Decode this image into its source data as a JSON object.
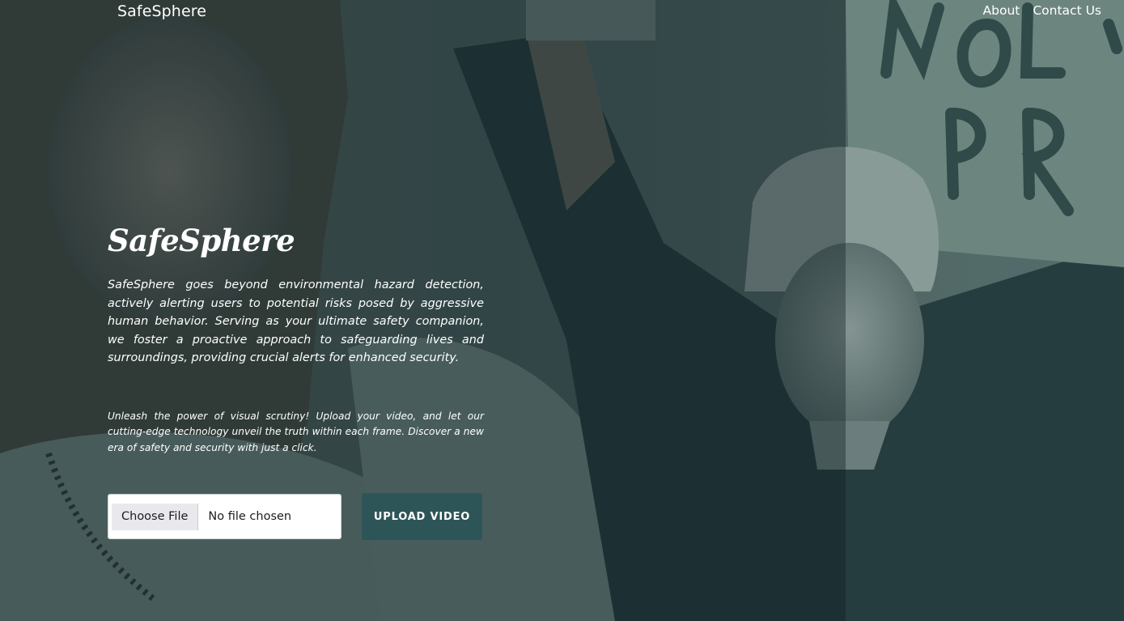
{
  "navbar": {
    "brand": "SafeSphere",
    "links": [
      {
        "label": "About"
      },
      {
        "label": "Contact Us"
      }
    ]
  },
  "hero": {
    "title": "SafeSphere",
    "description": "SafeSphere goes beyond environmental hazard detection, actively alerting users to potential risks posed by aggressive human behavior. Serving as your ultimate safety companion, we foster a proactive approach to safeguarding lives and surroundings, providing crucial alerts for enhanced security.",
    "subtext": "Unleash the power of visual scrutiny! Upload your video, and let our cutting-edge technology unveil the truth within each frame. Discover a new era of safety and security with just a click."
  },
  "upload": {
    "choose_file_label": "Choose File",
    "file_status": "No file chosen",
    "upload_button_label": "UPLOAD VIDEO"
  },
  "colors": {
    "overlay_tint": "#1c3438",
    "upload_button_bg": "#2d5558",
    "text": "#ffffff"
  }
}
